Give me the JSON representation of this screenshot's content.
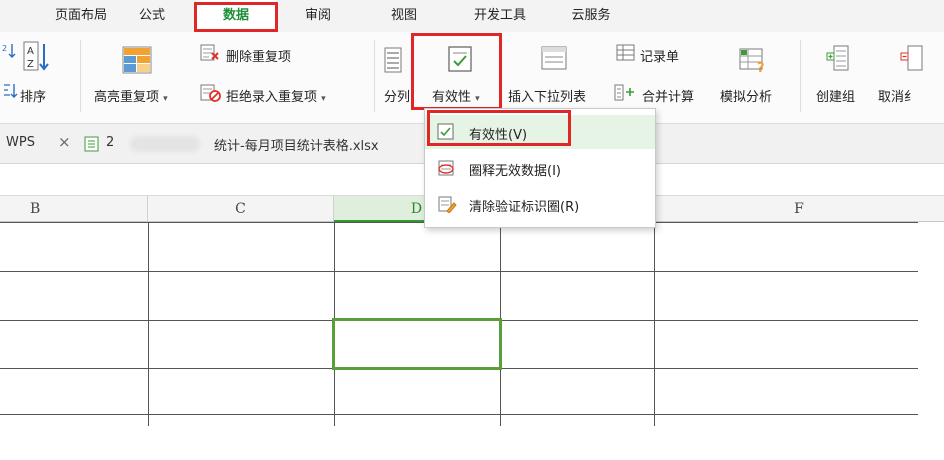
{
  "menu": {
    "tabs": [
      "页面布局",
      "公式",
      "数据",
      "审阅",
      "视图",
      "开发工具",
      "云服务"
    ],
    "active": "数据"
  },
  "ribbon": {
    "sort_label": "排序",
    "highlight_dup_label": "高亮重复项",
    "delete_dup_label": "删除重复项",
    "reject_dup_label": "拒绝录入重复项",
    "split_label": "分列",
    "validation_label": "有效性",
    "dropdown_list_label": "插入下拉列表",
    "record_label": "记录单",
    "merge_calc_label": "合并计算",
    "simulation_label": "模拟分析",
    "create_group_label": "创建组",
    "ungroup_label": "取消纟"
  },
  "doc_tabs": {
    "wps_label": "WPS",
    "close_symbol": "×",
    "file_prefix": "2",
    "file_suffix": "统计-每月项目统计表格.xlsx"
  },
  "sheet": {
    "columns": [
      "B",
      "C",
      "D",
      "",
      "F"
    ],
    "selected_column": "D"
  },
  "validation_menu": {
    "items": [
      "有效性(V)",
      "圈释无效数据(I)",
      "清除验证标识圈(R)"
    ]
  },
  "colors": {
    "accent_green": "#1f8f3a",
    "highlight_red": "#e02626",
    "selection_green": "#5a9e3a"
  }
}
